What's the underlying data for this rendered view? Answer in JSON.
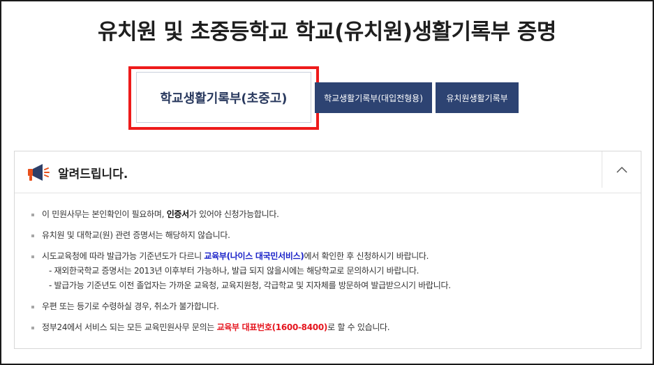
{
  "page": {
    "title": "유치원 및 초중등학교 학교(유치원)생활기록부 증명"
  },
  "tabs": [
    {
      "label": "학교생활기록부(초중고)",
      "active": true
    },
    {
      "label": "학교생활기록부(대입전형용)",
      "active": false
    },
    {
      "label": "유치원생활기록부",
      "active": false
    }
  ],
  "colors": {
    "tab_bg": "#2d4372",
    "highlight": "#ee1b1b",
    "link_blue": "#1a22c8",
    "phone_red": "#e5161f"
  },
  "notice": {
    "title": "알려드립니다.",
    "icon": "megaphone-icon",
    "collapse_icon": "chevron-up-icon",
    "items": {
      "i1": {
        "pre": "이 민원사무는 본인확인이 필요하며, ",
        "bold": "인증서",
        "post": "가 있어야 신청가능합니다."
      },
      "i2": {
        "text": "유치원 및 대학교(원) 관련 증명서는 해당하지 않습니다."
      },
      "i3": {
        "pre": "시도교육청에 따라 발급가능 기준년도가 다르니 ",
        "link": "교육부(나이스 대국민서비스)",
        "post": "에서 확인한 후 신청하시기 바랍니다.",
        "sub1": "- 재외한국학교 증명서는 2013년 이후부터 가능하나, 발급 되지 않을시에는 해당학교로 문의하시기 바랍니다.",
        "sub2": "- 발급가능 기준년도 이전 졸업자는 가까운 교육청, 교육지원청, 각급학교 및 지자체를 방문하여 발급받으시기 바랍니다."
      },
      "i4": {
        "text": "우편 또는 등기로 수령하실 경우, 취소가 불가합니다."
      },
      "i5": {
        "pre": "정부24에서 서비스 되는 모든 교육민원사무 문의는 ",
        "red": "교육부 대표번호(1600-8400)",
        "post": "로 할 수 있습니다."
      }
    }
  }
}
